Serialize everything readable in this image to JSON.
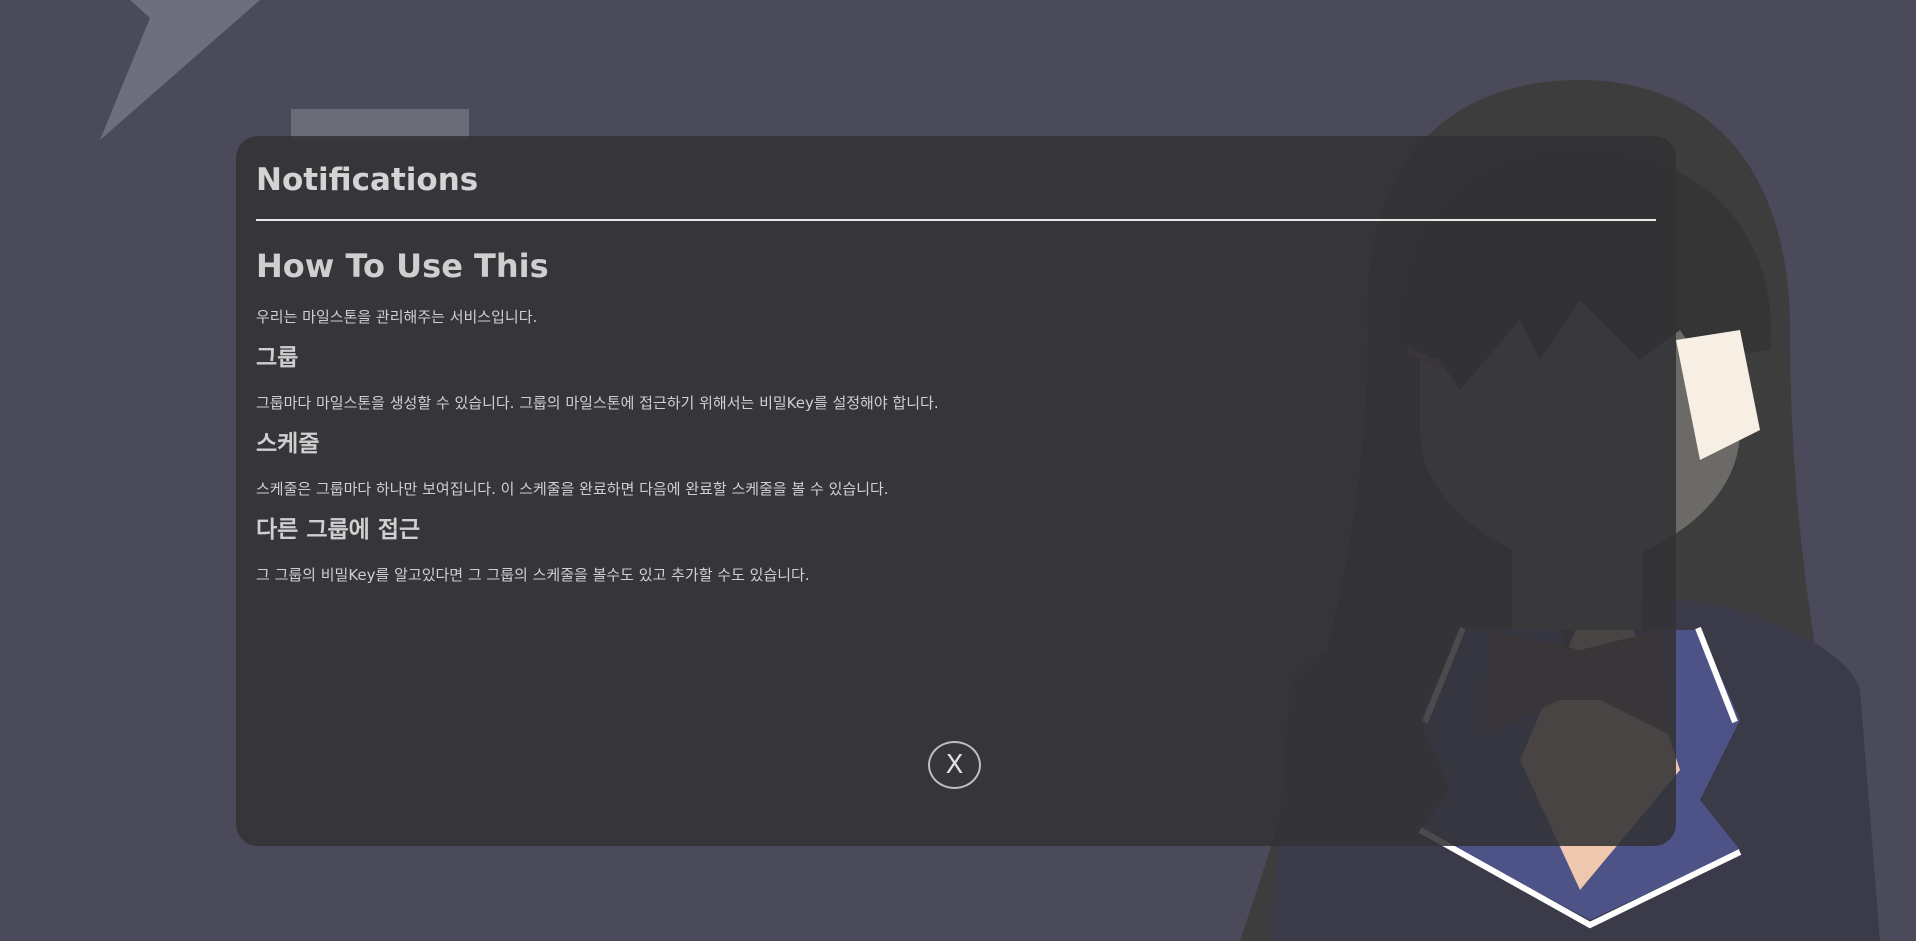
{
  "colors": {
    "page_background": "#4a4a5a",
    "modal_background": "#323236",
    "heading_text": "#cfcfcf",
    "body_text": "#d0d0d0",
    "divider": "#e8e8e8"
  },
  "modal": {
    "title": "Notifications",
    "heading": "How To Use This",
    "intro": "우리는 마일스톤을 관리해주는 서비스입니다.",
    "sections": [
      {
        "title": "그룹",
        "body": "그룹마다 마일스톤을 생성할 수 있습니다. 그룹의 마일스톤에 접근하기 위해서는 비밀Key를 설정해야 합니다."
      },
      {
        "title": "스케줄",
        "body": "스케줄은 그룹마다 하나만 보여집니다. 이 스케줄을 완료하면 다음에 완료할 스케줄을 볼 수 있습니다."
      },
      {
        "title": "다른 그룹에 접근",
        "body": "그 그룹의 비밀Key를 알고있다면 그 그룹의 스케줄을 볼수도 있고 추가할 수도 있습니다."
      }
    ],
    "close_label": "X"
  },
  "background": {
    "illustration": "anime-student-character"
  }
}
